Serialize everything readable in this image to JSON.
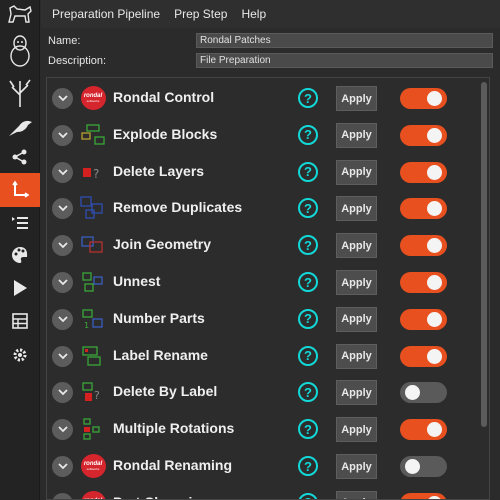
{
  "menu": [
    "Preparation Pipeline",
    "Prep Step",
    "Help"
  ],
  "form": {
    "name_label": "Name:",
    "name_value": "Rondal Patches",
    "description_label": "Description:",
    "description_value": "File Preparation"
  },
  "sidebar": {
    "items": [
      {
        "icon": "dog-icon"
      },
      {
        "icon": "penguin-icon"
      },
      {
        "icon": "tree-icon"
      },
      {
        "icon": "bird-icon"
      },
      {
        "icon": "share-icon"
      },
      {
        "icon": "axes-icon",
        "active": true
      },
      {
        "icon": "list-indent-icon"
      },
      {
        "icon": "palette-icon"
      },
      {
        "icon": "play-icon"
      },
      {
        "icon": "table-icon"
      },
      {
        "icon": "gear-icon"
      }
    ]
  },
  "steps": [
    {
      "name": "Rondal Control",
      "icon": "rondal-logo-icon",
      "apply_label": "Apply",
      "help_label": "?",
      "enabled": true
    },
    {
      "name": "Explode Blocks",
      "icon": "explode-blocks-icon",
      "apply_label": "Apply",
      "help_label": "?",
      "enabled": true
    },
    {
      "name": "Delete Layers",
      "icon": "delete-layers-icon",
      "apply_label": "Apply",
      "help_label": "?",
      "enabled": true
    },
    {
      "name": "Remove Duplicates",
      "icon": "remove-duplicates-icon",
      "apply_label": "Apply",
      "help_label": "?",
      "enabled": true
    },
    {
      "name": "Join Geometry",
      "icon": "join-geometry-icon",
      "apply_label": "Apply",
      "help_label": "?",
      "enabled": true
    },
    {
      "name": "Unnest",
      "icon": "unnest-icon",
      "apply_label": "Apply",
      "help_label": "?",
      "enabled": true
    },
    {
      "name": "Number Parts",
      "icon": "number-parts-icon",
      "apply_label": "Apply",
      "help_label": "?",
      "enabled": true
    },
    {
      "name": "Label Rename",
      "icon": "label-rename-icon",
      "apply_label": "Apply",
      "help_label": "?",
      "enabled": true
    },
    {
      "name": "Delete By Label",
      "icon": "delete-by-label-icon",
      "apply_label": "Apply",
      "help_label": "?",
      "enabled": false
    },
    {
      "name": "Multiple Rotations",
      "icon": "multiple-rotations-icon",
      "apply_label": "Apply",
      "help_label": "?",
      "enabled": true
    },
    {
      "name": "Rondal Renaming",
      "icon": "rondal-logo-icon",
      "apply_label": "Apply",
      "help_label": "?",
      "enabled": false
    },
    {
      "name": "Part Chopping",
      "icon": "rondal-logo-icon",
      "apply_label": "Apply",
      "help_label": "?",
      "enabled": true
    }
  ],
  "rondal_badge": {
    "text": "rondal",
    "sub": "softworks"
  },
  "colors": {
    "accent": "#e8501f",
    "help": "#12d8d8",
    "background": "#2b2b2b"
  }
}
